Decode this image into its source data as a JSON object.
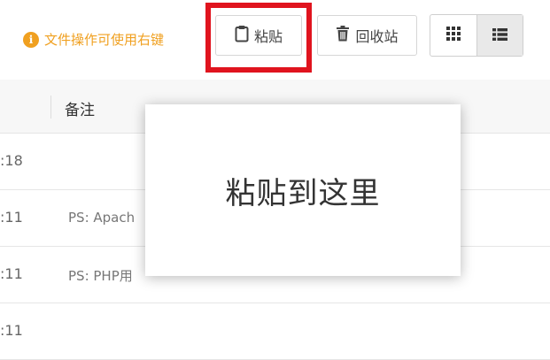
{
  "colors": {
    "hint": "#f0a020",
    "highlight": "#e0141e"
  },
  "toolbar": {
    "hint_text": "文件操作可使用右键",
    "hint_icon": "info-icon",
    "paste_label": "粘贴",
    "paste_icon": "clipboard-icon",
    "recycle_label": "回收站",
    "recycle_icon": "trash-icon",
    "view_grid_icon": "grid-view-icon",
    "view_list_icon": "list-view-icon",
    "active_view": "list"
  },
  "table": {
    "column_note": "备注",
    "rows": [
      {
        "time": ":18",
        "note": ""
      },
      {
        "time": ":11",
        "note": "PS: Apach"
      },
      {
        "time": ":11",
        "note": "PS: PHP用"
      },
      {
        "time": ":11",
        "note": ""
      }
    ]
  },
  "popup": {
    "text": "粘贴到这里"
  }
}
